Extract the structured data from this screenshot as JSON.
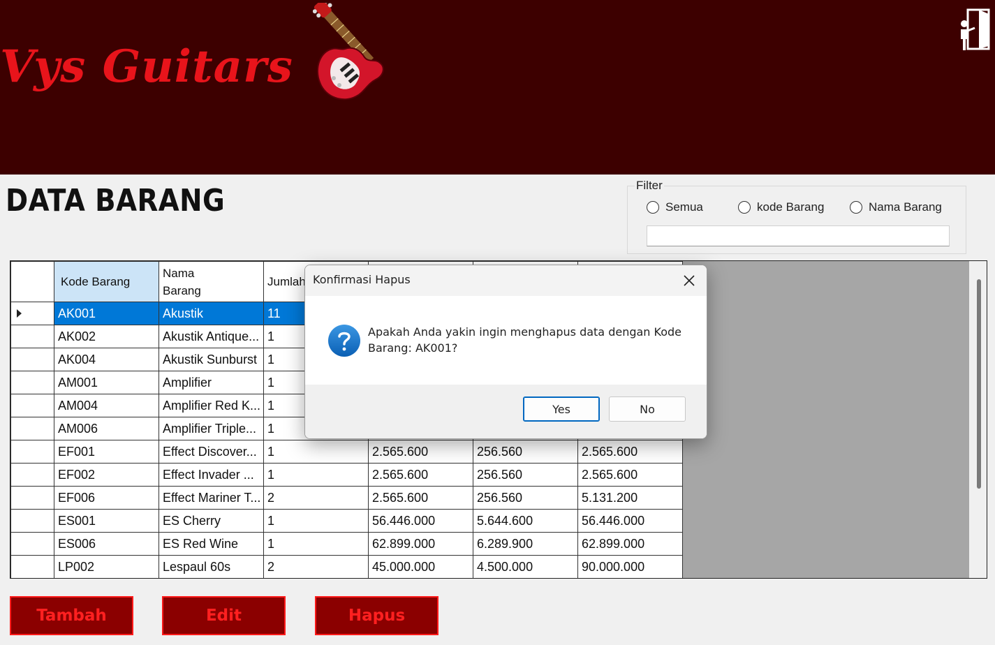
{
  "header": {
    "brand": "Vys Guitars",
    "exit_icon": "exit-door-icon"
  },
  "page": {
    "title": "DATA BARANG"
  },
  "filter": {
    "legend": "Filter",
    "options": [
      "Semua",
      "kode Barang",
      "Nama Barang"
    ],
    "search_value": ""
  },
  "table": {
    "columns": [
      "Kode Barang",
      "Nama\nBarang",
      "Jumlah",
      "",
      "",
      ""
    ],
    "rows": [
      [
        "AK001",
        "Akustik",
        "11",
        "",
        "",
        ""
      ],
      [
        "AK002",
        "Akustik Antique...",
        "1",
        "",
        "",
        ""
      ],
      [
        "AK004",
        "Akustik Sunburst",
        "1",
        "",
        "",
        ""
      ],
      [
        "AM001",
        "Amplifier",
        "1",
        "",
        "",
        ""
      ],
      [
        "AM004",
        "Amplifier Red K...",
        "1",
        "",
        "",
        ""
      ],
      [
        "AM006",
        "Amplifier Triple...",
        "1",
        "",
        "",
        ""
      ],
      [
        "EF001",
        "Effect Discover...",
        "1",
        "2.565.600",
        "256.560",
        "2.565.600"
      ],
      [
        "EF002",
        "Effect Invader ...",
        "1",
        "2.565.600",
        "256.560",
        "2.565.600"
      ],
      [
        "EF006",
        "Effect Mariner T...",
        "2",
        "2.565.600",
        "256.560",
        "5.131.200"
      ],
      [
        "ES001",
        "ES Cherry",
        "1",
        "56.446.000",
        "5.644.600",
        "56.446.000"
      ],
      [
        "ES006",
        "ES Red Wine",
        "1",
        "62.899.000",
        "6.289.900",
        "62.899.000"
      ],
      [
        "LP002",
        "Lespaul 60s",
        "2",
        "45.000.000",
        "4.500.000",
        "90.000.000"
      ]
    ],
    "selected_row": 0
  },
  "actions": {
    "add": "Tambah",
    "edit": "Edit",
    "delete": "Hapus"
  },
  "dialog": {
    "title": "Konfirmasi Hapus",
    "message": "Apakah Anda yakin ingin menghapus data dengan Kode Barang: AK001?",
    "yes": "Yes",
    "no": "No",
    "icon": "question-icon"
  },
  "colors": {
    "header_bg": "#3d0000",
    "brand_red": "#e8141b",
    "button_bg": "#8b0000",
    "selection": "#0078d7"
  }
}
